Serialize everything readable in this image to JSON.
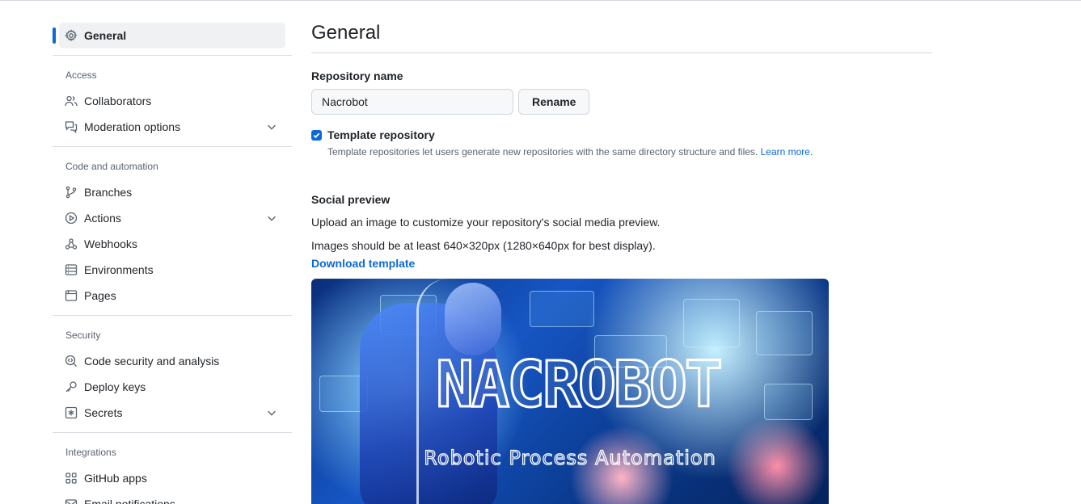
{
  "sidebar": {
    "general": {
      "label": "General",
      "icon": "gear-icon"
    },
    "sections": {
      "access": {
        "heading": "Access"
      },
      "code": {
        "heading": "Code and automation"
      },
      "security": {
        "heading": "Security"
      },
      "integrations": {
        "heading": "Integrations"
      }
    },
    "items": {
      "collaborators": "Collaborators",
      "moderation": "Moderation options",
      "branches": "Branches",
      "actions": "Actions",
      "webhooks": "Webhooks",
      "environments": "Environments",
      "pages": "Pages",
      "code_security": "Code security and analysis",
      "deploy_keys": "Deploy keys",
      "secrets": "Secrets",
      "github_apps": "GitHub apps",
      "email_notifications": "Email notifications"
    }
  },
  "main": {
    "title": "General",
    "repo_name_label": "Repository name",
    "repo_name_value": "Nacrobot",
    "rename_label": "Rename",
    "template_label": "Template repository",
    "template_checked": true,
    "template_note": "Template repositories let users generate new repositories with the same directory structure and files.",
    "learn_more": "Learn more.",
    "social_preview_label": "Social preview",
    "social_desc": "Upload an image to customize your repository's social media preview.",
    "social_size": "Images should be at least 640×320px (1280×640px for best display).",
    "download_template": "Download template",
    "preview_title": "NACROBOT",
    "preview_subtitle": "Robotic Process Automation"
  },
  "colors": {
    "accent": "#0969da",
    "muted": "#59636e",
    "border": "#d0d7de"
  }
}
